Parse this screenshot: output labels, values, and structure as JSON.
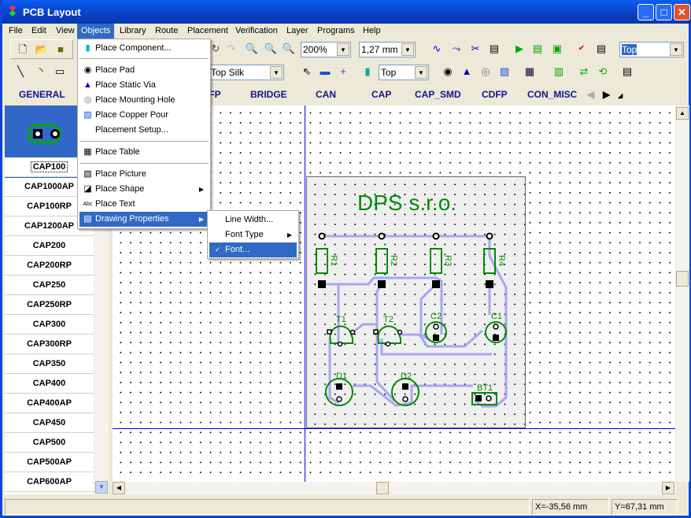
{
  "window": {
    "title": "PCB Layout"
  },
  "menubar": [
    "File",
    "Edit",
    "View",
    "Objects",
    "Library",
    "Route",
    "Placement",
    "Verification",
    "Layer",
    "Programs",
    "Help"
  ],
  "toolbar": {
    "zoom": "200%",
    "grid": "1,27 mm",
    "layer_top": "Top",
    "silk_layer": "Top Silk",
    "pad_layer": "Top"
  },
  "tabs": [
    "GENERAL",
    "QFP",
    "BRIDGE",
    "CAN",
    "CAP",
    "CAP_SMD",
    "CDFP",
    "CON_MISC"
  ],
  "library": {
    "selected": "CAP100",
    "items": [
      "CAP100",
      "CAP1000AP",
      "CAP100RP",
      "CAP1200AP",
      "CAP200",
      "CAP200RP",
      "CAP250",
      "CAP250RP",
      "CAP300",
      "CAP300RP",
      "CAP350",
      "CAP400",
      "CAP400AP",
      "CAP450",
      "CAP500",
      "CAP500AP",
      "CAP600AP"
    ]
  },
  "objects_menu": {
    "items": [
      {
        "label": "Place Component...",
        "icon": "component-icon"
      },
      {
        "label": "Place Pad",
        "icon": "pad-icon"
      },
      {
        "label": "Place Static Via",
        "icon": "via-icon"
      },
      {
        "label": "Place Mounting Hole",
        "icon": "mounting-hole-icon"
      },
      {
        "label": "Place Copper Pour",
        "icon": "copper-pour-icon"
      },
      {
        "label": "Placement Setup...",
        "icon": ""
      },
      {
        "label": "Place Table",
        "icon": "table-icon"
      },
      {
        "label": "Place Picture",
        "icon": "picture-icon"
      },
      {
        "label": "Place Shape",
        "icon": "shape-icon"
      },
      {
        "label": "Place Text",
        "icon": "text-icon"
      },
      {
        "label": "Drawing Properties",
        "icon": "properties-icon"
      }
    ]
  },
  "drawing_submenu": {
    "items": [
      "Line Width...",
      "Font Type",
      "Font..."
    ]
  },
  "pcb": {
    "title": "DPS s.r.o.",
    "labels": [
      "R1",
      "R2",
      "R3",
      "R4",
      "T1",
      "T2",
      "C2",
      "C1",
      "D1",
      "D2",
      "BT1"
    ]
  },
  "status": {
    "x": "X=-35,56 mm",
    "y": "Y=67,31 mm"
  },
  "colors": {
    "silk": "#008c00",
    "trace": "#9999ee",
    "menu_highlight": "#316ac5",
    "titlebar": "#0a46d8"
  }
}
